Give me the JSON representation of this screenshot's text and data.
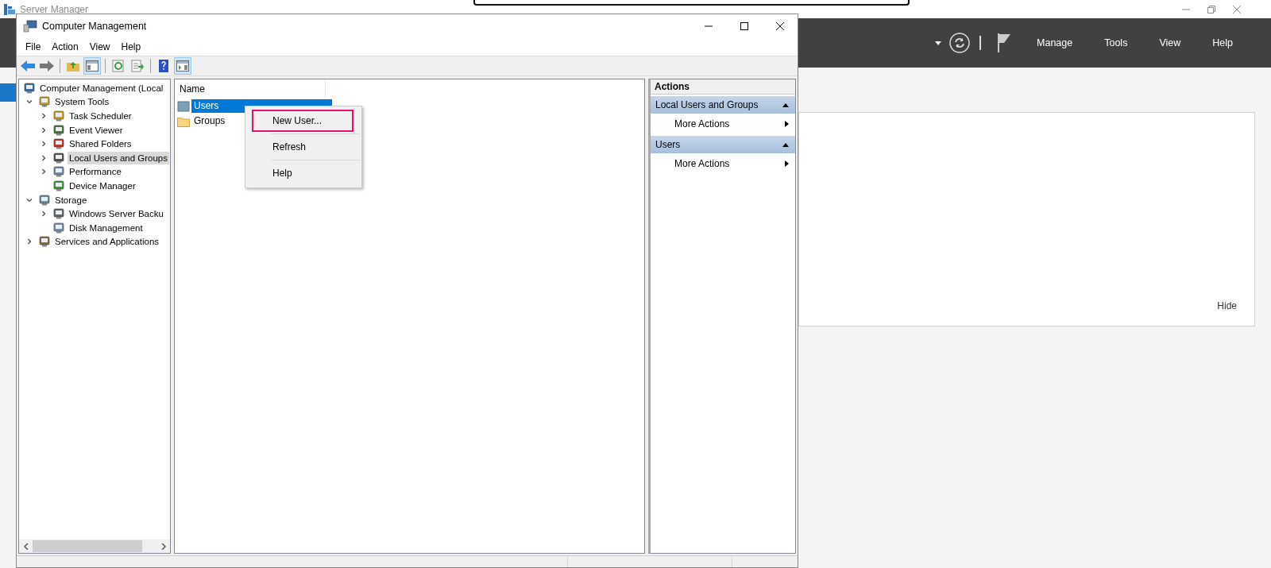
{
  "background_window": {
    "title": "Server Manager",
    "header_menu": [
      "Manage",
      "Tools",
      "View",
      "Help"
    ],
    "panel_link": "Hide"
  },
  "window": {
    "title": "Computer Management",
    "menu": [
      "File",
      "Action",
      "View",
      "Help"
    ]
  },
  "tree": [
    {
      "label": "Computer Management (Local",
      "selected": false,
      "children": [
        {
          "label": "System Tools",
          "expandable": true,
          "expanded": true,
          "selected": false,
          "children": [
            {
              "label": "Task Scheduler",
              "expandable": true,
              "expanded": false,
              "selected": false
            },
            {
              "label": "Event Viewer",
              "expandable": true,
              "expanded": false,
              "selected": false
            },
            {
              "label": "Shared Folders",
              "expandable": true,
              "expanded": false,
              "selected": false
            },
            {
              "label": "Local Users and Groups",
              "expandable": true,
              "expanded": false,
              "selected": true
            },
            {
              "label": "Performance",
              "expandable": true,
              "expanded": false,
              "selected": false
            },
            {
              "label": "Device Manager",
              "expandable": false,
              "selected": false
            }
          ]
        },
        {
          "label": "Storage",
          "expandable": true,
          "expanded": true,
          "selected": false,
          "children": [
            {
              "label": "Windows Server Backu",
              "expandable": true,
              "expanded": false,
              "selected": false
            },
            {
              "label": "Disk Management",
              "expandable": false,
              "selected": false
            }
          ]
        },
        {
          "label": "Services and Applications",
          "expandable": true,
          "expanded": false,
          "selected": false
        }
      ]
    }
  ],
  "list": {
    "columns": [
      "Name"
    ],
    "rows": [
      {
        "name": "Users",
        "selected": true
      },
      {
        "name": "Groups",
        "selected": false
      }
    ]
  },
  "context_menu": [
    {
      "label": "New User...",
      "highlighted": true
    },
    {
      "label": "Refresh",
      "highlighted": false
    },
    {
      "label": "Help",
      "highlighted": false
    }
  ],
  "actions": {
    "title": "Actions",
    "sections": [
      {
        "title": "Local Users and Groups",
        "items": [
          "More Actions"
        ]
      },
      {
        "title": "Users",
        "items": [
          "More Actions"
        ]
      }
    ]
  }
}
